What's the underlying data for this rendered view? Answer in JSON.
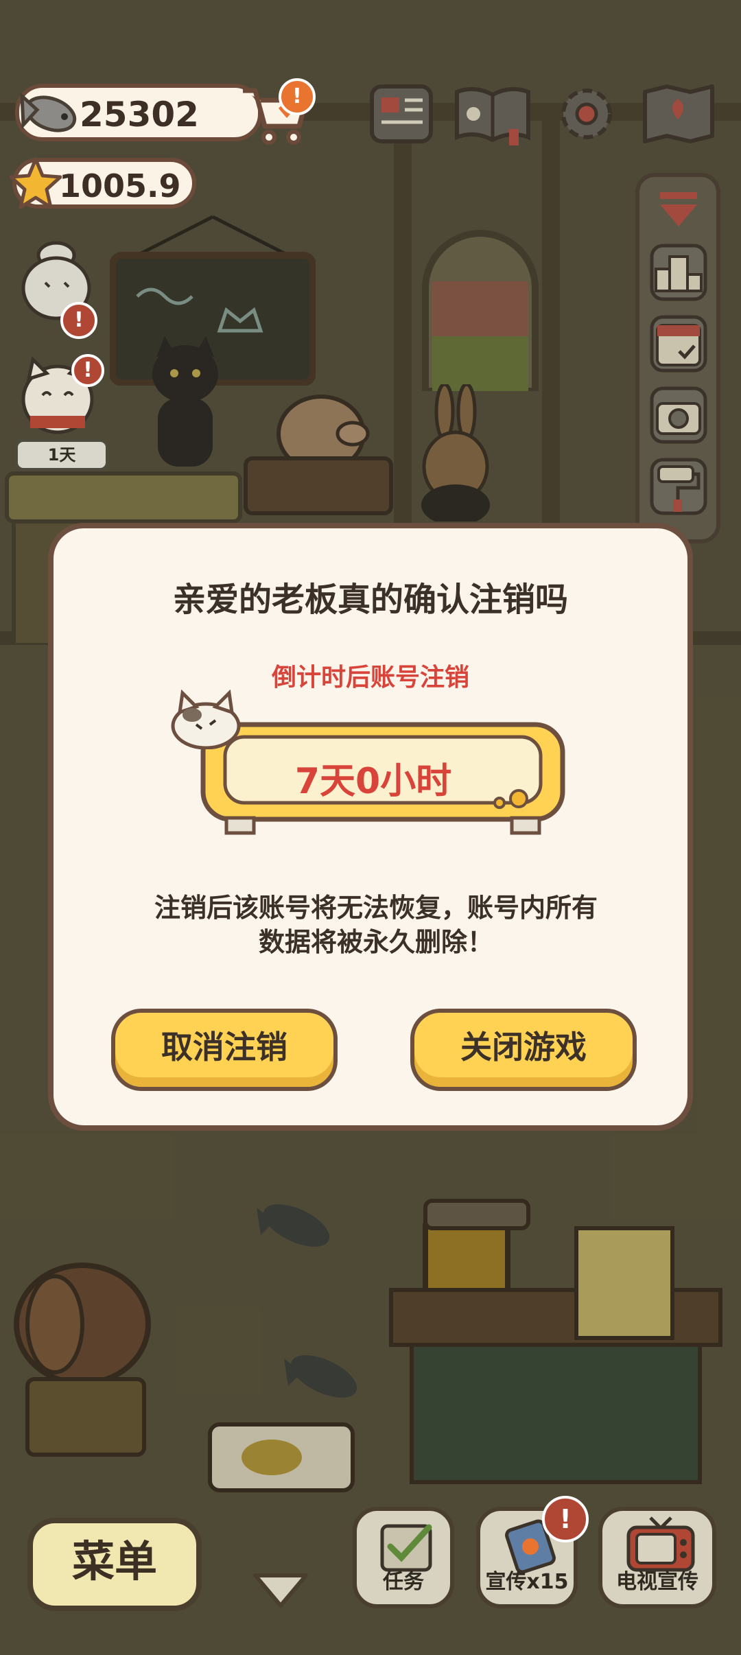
{
  "resources": {
    "fish_coins": "25302",
    "stars": "1005.9"
  },
  "shop": {
    "alert_badge": "!"
  },
  "icons": {
    "fish": "fish-icon",
    "star": "star-icon",
    "cart": "shopping-cart-icon",
    "news": "newspaper-icon",
    "book": "recipe-book-icon",
    "settings": "gear-icon",
    "map": "map-icon",
    "collapse": "triangle-down-icon",
    "ranking": "podium-icon",
    "calendar": "calendar-icon",
    "camera": "camera-icon",
    "paint": "paint-roller-icon"
  },
  "left_widgets": {
    "lucky_cat_days": "1天",
    "alert_badge": "!"
  },
  "dialog": {
    "title": "亲爱的老板真的确认注销吗",
    "countdown_label": "倒计时后账号注销",
    "countdown_value": "7天0小时",
    "warning_line1": "注销后该账号将无法恢复，账号内所有",
    "warning_line2": "数据将被永久删除！",
    "cancel_button": "取消注销",
    "close_button": "关闭游戏"
  },
  "bottom_bar": {
    "menu": "菜单",
    "tasks": "任务",
    "promo": "宣传x15",
    "tv_promo": "电视宣传",
    "promo_badge": "!"
  },
  "colors": {
    "accent_yellow": "#ffd253",
    "alert_red": "#d9443a",
    "badge_orange": "#e8742f",
    "outline_brown": "#6c4f3f"
  }
}
